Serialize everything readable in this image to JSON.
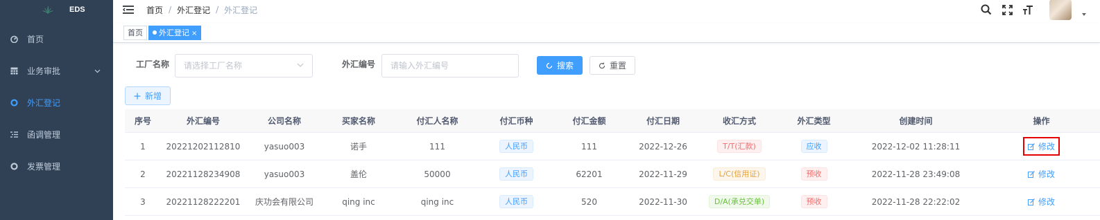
{
  "app": {
    "name": "EDS"
  },
  "sidebar": {
    "items": [
      {
        "label": "首页",
        "icon": "dashboard-icon"
      },
      {
        "label": "业务审批",
        "icon": "table-icon"
      },
      {
        "label": "外汇登记",
        "icon": "circle-icon"
      },
      {
        "label": "函调管理",
        "icon": "list-icon"
      },
      {
        "label": "发票管理",
        "icon": "circle-icon"
      }
    ],
    "active_index": 2
  },
  "breadcrumb": {
    "home": "首页",
    "sep1": "/",
    "parent": "外汇登记",
    "sep2": "/",
    "current": "外汇登记"
  },
  "tags": {
    "home": "首页",
    "current": "外汇登记",
    "close": "×"
  },
  "search": {
    "factory_label": "工厂名称",
    "factory_placeholder": "请选择工厂名称",
    "fx_label": "外汇编号",
    "fx_placeholder": "请输入外汇编号",
    "search_button": "搜索",
    "reset_button": "重置"
  },
  "actions": {
    "add_button": "新增"
  },
  "table": {
    "headers": [
      "序号",
      "外汇编号",
      "公司名称",
      "买家名称",
      "付汇人名称",
      "付汇币种",
      "付汇金额",
      "付汇日期",
      "收汇方式",
      "外汇类型",
      "创建时间",
      "操作"
    ],
    "rows": [
      {
        "no": "1",
        "fx_no": "20221202112810",
        "company": "yasuo003",
        "buyer": "诺手",
        "payer": "111",
        "currency": "人民币",
        "amount": "111",
        "date": "2022-12-26",
        "method": "T/T(汇款)",
        "method_color": "red",
        "type": "应收",
        "type_color": "blue",
        "created": "2022-12-02 11:28:11",
        "op": "修改"
      },
      {
        "no": "2",
        "fx_no": "20221128234908",
        "company": "yasuo003",
        "buyer": "盖伦",
        "payer": "50000",
        "currency": "人民币",
        "amount": "62201",
        "date": "2022-11-29",
        "method": "L/C(信用证)",
        "method_color": "orange",
        "type": "预收",
        "type_color": "red",
        "created": "2022-11-28 23:49:08",
        "op": "修改"
      },
      {
        "no": "3",
        "fx_no": "20221128222201",
        "company": "庆功会有限公司",
        "buyer": "qing inc",
        "payer": "qing inc",
        "currency": "人民币",
        "amount": "520",
        "date": "2022-11-30",
        "method": "D/A(承兑交单)",
        "method_color": "green",
        "type": "预收",
        "type_color": "red",
        "created": "2022-11-28 22:22:02",
        "op": "修改"
      }
    ]
  },
  "colors": {
    "sidebar_bg": "#304156",
    "primary": "#409eff",
    "highlight_box": "#e60000"
  }
}
